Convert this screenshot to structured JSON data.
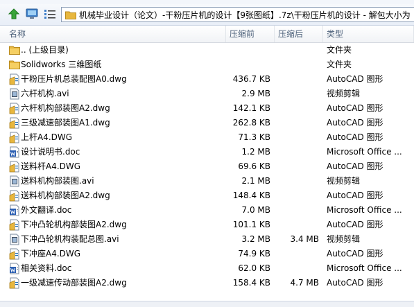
{
  "menu": [],
  "address": {
    "path": "机械毕业设计（论文）-干粉压片机的设计【9张图纸】.7z\\干粉压片机的设计 - 解包大小为"
  },
  "columns": {
    "name": "名称",
    "size": "压缩前",
    "packed": "压缩后",
    "type": "类型"
  },
  "files": [
    {
      "name": ".. (上级目录)",
      "size": "",
      "packed": "",
      "type": "文件夹",
      "icon": "folder-icon"
    },
    {
      "name": "Solidworks 三维图纸",
      "size": "",
      "packed": "",
      "type": "文件夹",
      "icon": "folder-icon"
    },
    {
      "name": "干粉压片机总装配图A0.dwg",
      "size": "436.7 KB",
      "packed": "",
      "type": "AutoCAD 图形",
      "icon": "dwg-file-icon"
    },
    {
      "name": "六杆机构.avi",
      "size": "2.9 MB",
      "packed": "",
      "type": "视频剪辑",
      "icon": "video-file-icon"
    },
    {
      "name": "六杆机构部装图A2.dwg",
      "size": "142.1 KB",
      "packed": "",
      "type": "AutoCAD 图形",
      "icon": "dwg-file-icon"
    },
    {
      "name": "三级减速部装图A1.dwg",
      "size": "262.8 KB",
      "packed": "",
      "type": "AutoCAD 图形",
      "icon": "dwg-file-icon"
    },
    {
      "name": "上杆A4.DWG",
      "size": "71.3 KB",
      "packed": "",
      "type": "AutoCAD 图形",
      "icon": "dwg-file-icon"
    },
    {
      "name": "设计说明书.doc",
      "size": "1.2 MB",
      "packed": "",
      "type": "Microsoft Office ...",
      "icon": "doc-file-icon"
    },
    {
      "name": "送料杆A4.DWG",
      "size": "69.6 KB",
      "packed": "",
      "type": "AutoCAD 图形",
      "icon": "dwg-file-icon"
    },
    {
      "name": "送料机构部装图.avi",
      "size": "2.1 MB",
      "packed": "",
      "type": "视频剪辑",
      "icon": "video-file-icon"
    },
    {
      "name": "送料机构部装图A2.dwg",
      "size": "148.4 KB",
      "packed": "",
      "type": "AutoCAD 图形",
      "icon": "dwg-file-icon"
    },
    {
      "name": "外文翻译.doc",
      "size": "7.0 MB",
      "packed": "",
      "type": "Microsoft Office ...",
      "icon": "doc-file-icon"
    },
    {
      "name": "下冲凸轮机构部装图A2.dwg",
      "size": "101.1 KB",
      "packed": "",
      "type": "AutoCAD 图形",
      "icon": "dwg-file-icon"
    },
    {
      "name": "下冲凸轮机构装配总图.avi",
      "size": "3.2 MB",
      "packed": "3.4 MB",
      "type": "视频剪辑",
      "icon": "video-file-icon"
    },
    {
      "name": "下冲座A4.DWG",
      "size": "74.9 KB",
      "packed": "",
      "type": "AutoCAD 图形",
      "icon": "dwg-file-icon"
    },
    {
      "name": "相关资料.doc",
      "size": "62.0 KB",
      "packed": "",
      "type": "Microsoft Office ...",
      "icon": "doc-file-icon"
    },
    {
      "name": "一级减速传动部装图A2.dwg",
      "size": "158.4 KB",
      "packed": "4.7 MB",
      "type": "AutoCAD 图形",
      "icon": "dwg-file-icon"
    }
  ],
  "colors": {
    "folder": "#e8b73e",
    "dwg_accent": "#1f6fb8",
    "header_text": "#4c607a",
    "up_arrow": "#3aa53a"
  }
}
